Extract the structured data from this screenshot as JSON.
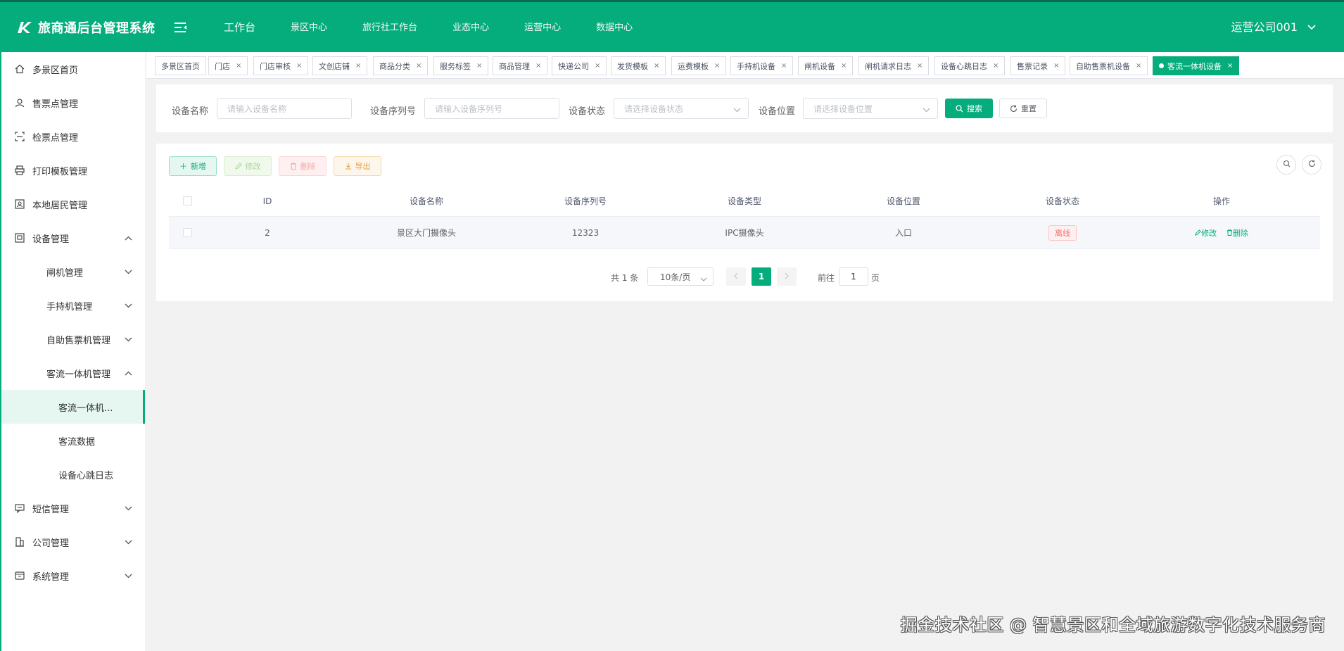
{
  "app": {
    "title": "旅商通后台管理系统",
    "user": "运营公司001"
  },
  "top_nav": [
    "工作台",
    "景区中心",
    "旅行社工作台",
    "业态中心",
    "运营中心",
    "数据中心"
  ],
  "sidebar": {
    "items": [
      {
        "label": "多景区首页",
        "icon": "home-icon"
      },
      {
        "label": "售票点管理",
        "icon": "user-icon"
      },
      {
        "label": "检票点管理",
        "icon": "scan-icon"
      },
      {
        "label": "打印模板管理",
        "icon": "print-icon"
      },
      {
        "label": "本地居民管理",
        "icon": "id-card-icon"
      },
      {
        "label": "设备管理",
        "icon": "device-icon",
        "state": "expanded"
      },
      {
        "label": "闸机管理",
        "state": "collapsed"
      },
      {
        "label": "手持机管理",
        "state": "collapsed"
      },
      {
        "label": "自助售票机管理",
        "state": "collapsed"
      },
      {
        "label": "客流一体机管理",
        "state": "expanded"
      },
      {
        "label": "客流一体机...",
        "active": true
      },
      {
        "label": "客流数据"
      },
      {
        "label": "设备心跳日志"
      },
      {
        "label": "短信管理",
        "icon": "message-icon",
        "state": "collapsed"
      },
      {
        "label": "公司管理",
        "icon": "building-icon",
        "state": "collapsed"
      },
      {
        "label": "系统管理",
        "icon": "system-icon",
        "state": "collapsed"
      }
    ]
  },
  "tabs": [
    {
      "label": "多景区首页",
      "closable": false
    },
    {
      "label": "门店",
      "closable": true
    },
    {
      "label": "门店审核",
      "closable": true
    },
    {
      "label": "文创店铺",
      "closable": true
    },
    {
      "label": "商品分类",
      "closable": true
    },
    {
      "label": "服务标签",
      "closable": true
    },
    {
      "label": "商品管理",
      "closable": true
    },
    {
      "label": "快递公司",
      "closable": true
    },
    {
      "label": "发货模板",
      "closable": true
    },
    {
      "label": "运费模板",
      "closable": true
    },
    {
      "label": "手持机设备",
      "closable": true
    },
    {
      "label": "闸机设备",
      "closable": true
    },
    {
      "label": "闸机请求日志",
      "closable": true
    },
    {
      "label": "设备心跳日志",
      "closable": true
    },
    {
      "label": "售票记录",
      "closable": true
    },
    {
      "label": "自助售票机设备",
      "closable": true
    },
    {
      "label": "客流一体机设备",
      "closable": true,
      "active": true
    }
  ],
  "tab_close_glyph": "×",
  "search": {
    "name_label": "设备名称",
    "name_placeholder": "请输入设备名称",
    "serial_label": "设备序列号",
    "serial_placeholder": "请输入设备序列号",
    "status_label": "设备状态",
    "status_placeholder": "请选择设备状态",
    "location_label": "设备位置",
    "location_placeholder": "请选择设备位置",
    "search_button": "搜索",
    "reset_button": "重置"
  },
  "toolbar": {
    "add": "新增",
    "edit": "修改",
    "delete": "删除",
    "export": "导出"
  },
  "table": {
    "columns": [
      "ID",
      "设备名称",
      "设备序列号",
      "设备类型",
      "设备位置",
      "设备状态",
      "操作"
    ],
    "rows": [
      {
        "id": "2",
        "name": "景区大门摄像头",
        "serial": "12323",
        "type": "IPC摄像头",
        "location": "入口",
        "status": "离线",
        "edit": "修改",
        "delete": "删除"
      }
    ]
  },
  "pagination": {
    "total": "共 1 条",
    "page_size": "10条/页",
    "current": "1",
    "goto_label": "前往",
    "goto_value": "1",
    "page_label": "页"
  },
  "watermark": "掘金技术社区 @ 智慧景区和全域旅游数字化技术服务商",
  "colors": {
    "primary": "#05ad7c",
    "danger": "#f56c6c",
    "warning": "#e6a23c"
  }
}
